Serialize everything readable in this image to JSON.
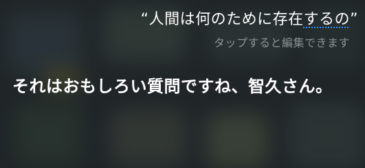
{
  "siri": {
    "query_open_quote": "“",
    "query_text": "人間は何のために存在",
    "query_highlighted": "するの",
    "query_close_quote": "”",
    "edit_hint": "タップすると編集できます",
    "response_text": "それはおもしろい質問ですね、智久さん。"
  },
  "colors": {
    "underline": "#2f8cff",
    "text": "#ffffff",
    "hint": "#dce1e4"
  }
}
